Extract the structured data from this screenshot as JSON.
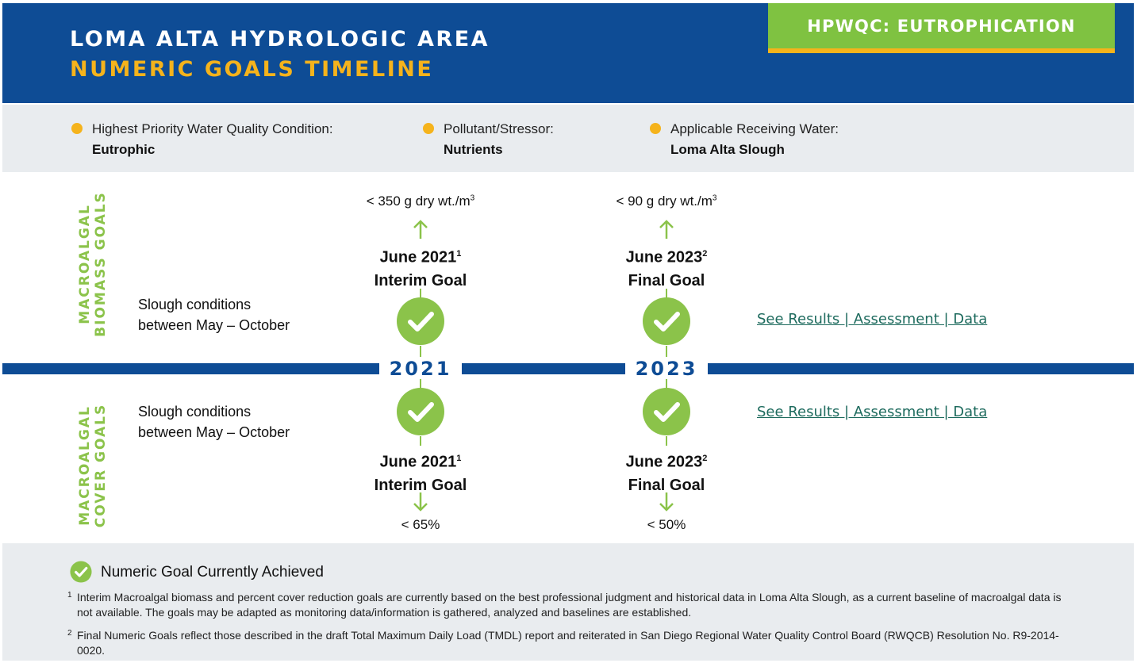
{
  "header": {
    "title_line1": "LOMA ALTA HYDROLOGIC AREA",
    "title_line2": "NUMERIC GOALS TIMELINE",
    "badge": "HPWQC: EUTROPHICATION",
    "colors": {
      "navy": "#0e4c95",
      "gold": "#f5b31c",
      "green": "#7fc241"
    }
  },
  "info": [
    {
      "label": "Highest Priority Water Quality Condition:",
      "value": "Eutrophic"
    },
    {
      "label": "Pollutant/Stressor:",
      "value": "Nutrients"
    },
    {
      "label": "Applicable Receiving Water:",
      "value": "Loma Alta Slough"
    }
  ],
  "biomass": {
    "section_label_line1": "MACROALGAL",
    "section_label_line2": "BIOMASS GOALS",
    "condition_line1": "Slough conditions",
    "condition_line2": "between May – October",
    "interim": {
      "value": "< 350 g dry wt./m",
      "value_sup": "3",
      "date": "June 2021",
      "note_ref": "1",
      "goal": "Interim Goal",
      "achieved": true
    },
    "final": {
      "value": "< 90 g dry wt./m",
      "value_sup": "3",
      "date": "June 2023",
      "note_ref": "2",
      "goal": "Final Goal",
      "achieved": true
    },
    "links": "See Results | Assessment | Data"
  },
  "timeline": {
    "years": [
      "2021",
      "2023"
    ]
  },
  "cover": {
    "section_label_line1": "MACROALGAL",
    "section_label_line2": "COVER GOALS",
    "condition_line1": "Slough conditions",
    "condition_line2": "between May – October",
    "interim": {
      "value": "< 65%",
      "date": "June 2021",
      "note_ref": "1",
      "goal": "Interim Goal",
      "achieved": true
    },
    "final": {
      "value": "< 50%",
      "date": "June 2023",
      "note_ref": "2",
      "goal": "Final Goal",
      "achieved": true
    },
    "links": "See Results | Assessment | Data"
  },
  "footer": {
    "legend": "Numeric Goal Currently Achieved",
    "notes": [
      {
        "num": "1",
        "text": "Interim Macroalgal biomass and percent cover reduction goals are currently based on the best professional judgment and historical data in Loma Alta Slough, as a current baseline of macroalgal data is not available. The goals may be adapted as monitoring data/information is gathered, analyzed and baselines are established."
      },
      {
        "num": "2",
        "text": "Final Numeric Goals reflect those described in the draft Total Maximum Daily Load (TMDL) report and reiterated in San Diego Regional Water Quality Control Board (RWQCB) Resolution No. R9-2014-0020."
      }
    ]
  }
}
